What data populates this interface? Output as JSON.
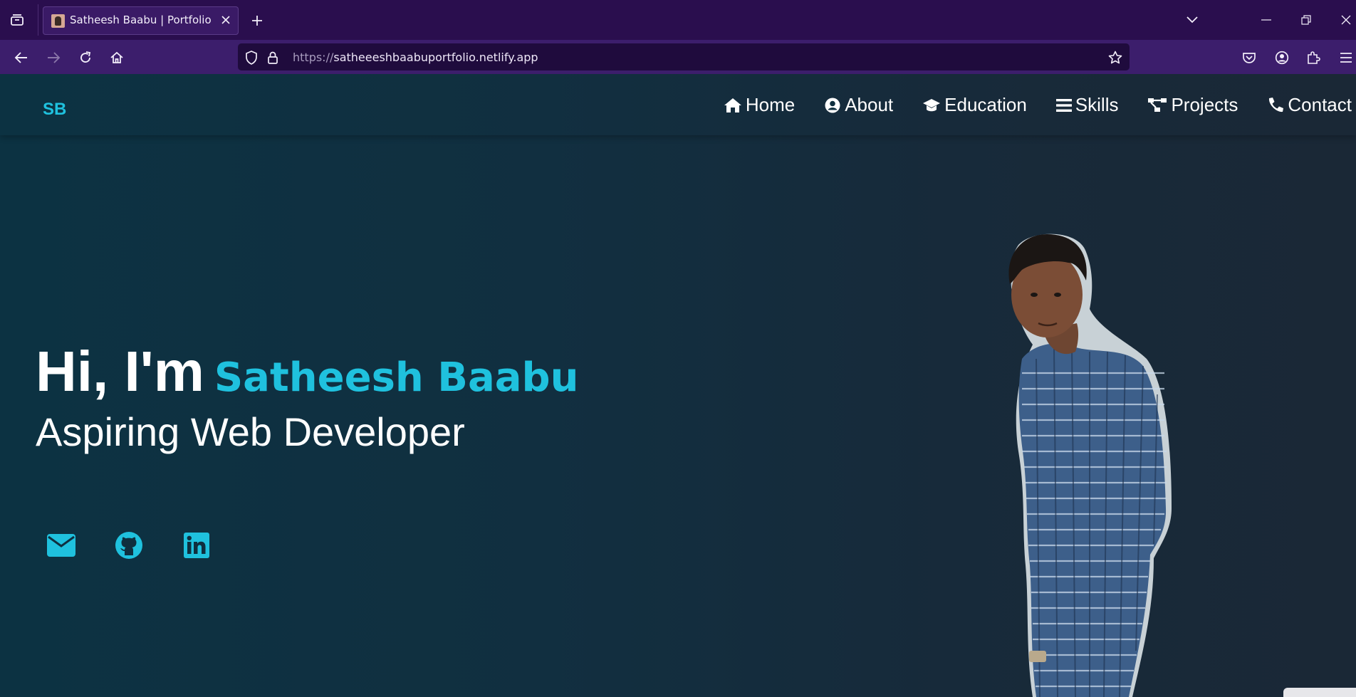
{
  "browser": {
    "tab": {
      "title": "Satheesh Baabu | Portfolio"
    },
    "url": {
      "scheme": "https://",
      "host": "satheeeshbaabuportfolio.netlify.app"
    }
  },
  "site": {
    "logo": "SB",
    "nav": [
      {
        "label": "Home",
        "icon": "home-icon"
      },
      {
        "label": "About",
        "icon": "user-circle-icon"
      },
      {
        "label": "Education",
        "icon": "graduation-cap-icon"
      },
      {
        "label": "Skills",
        "icon": "bars-icon"
      },
      {
        "label": "Projects",
        "icon": "project-diagram-icon"
      },
      {
        "label": "Contact",
        "icon": "phone-icon"
      }
    ],
    "hero": {
      "greeting": "Hi, I'm",
      "name": "Satheesh Baabu",
      "role": "Aspiring Web Developer"
    },
    "socials": [
      {
        "icon": "envelope-icon"
      },
      {
        "icon": "github-icon"
      },
      {
        "icon": "linkedin-icon"
      }
    ],
    "colors": {
      "accent": "#1fc1de",
      "background": "#0f2936",
      "browser_chrome": "#2a0e4e"
    }
  }
}
